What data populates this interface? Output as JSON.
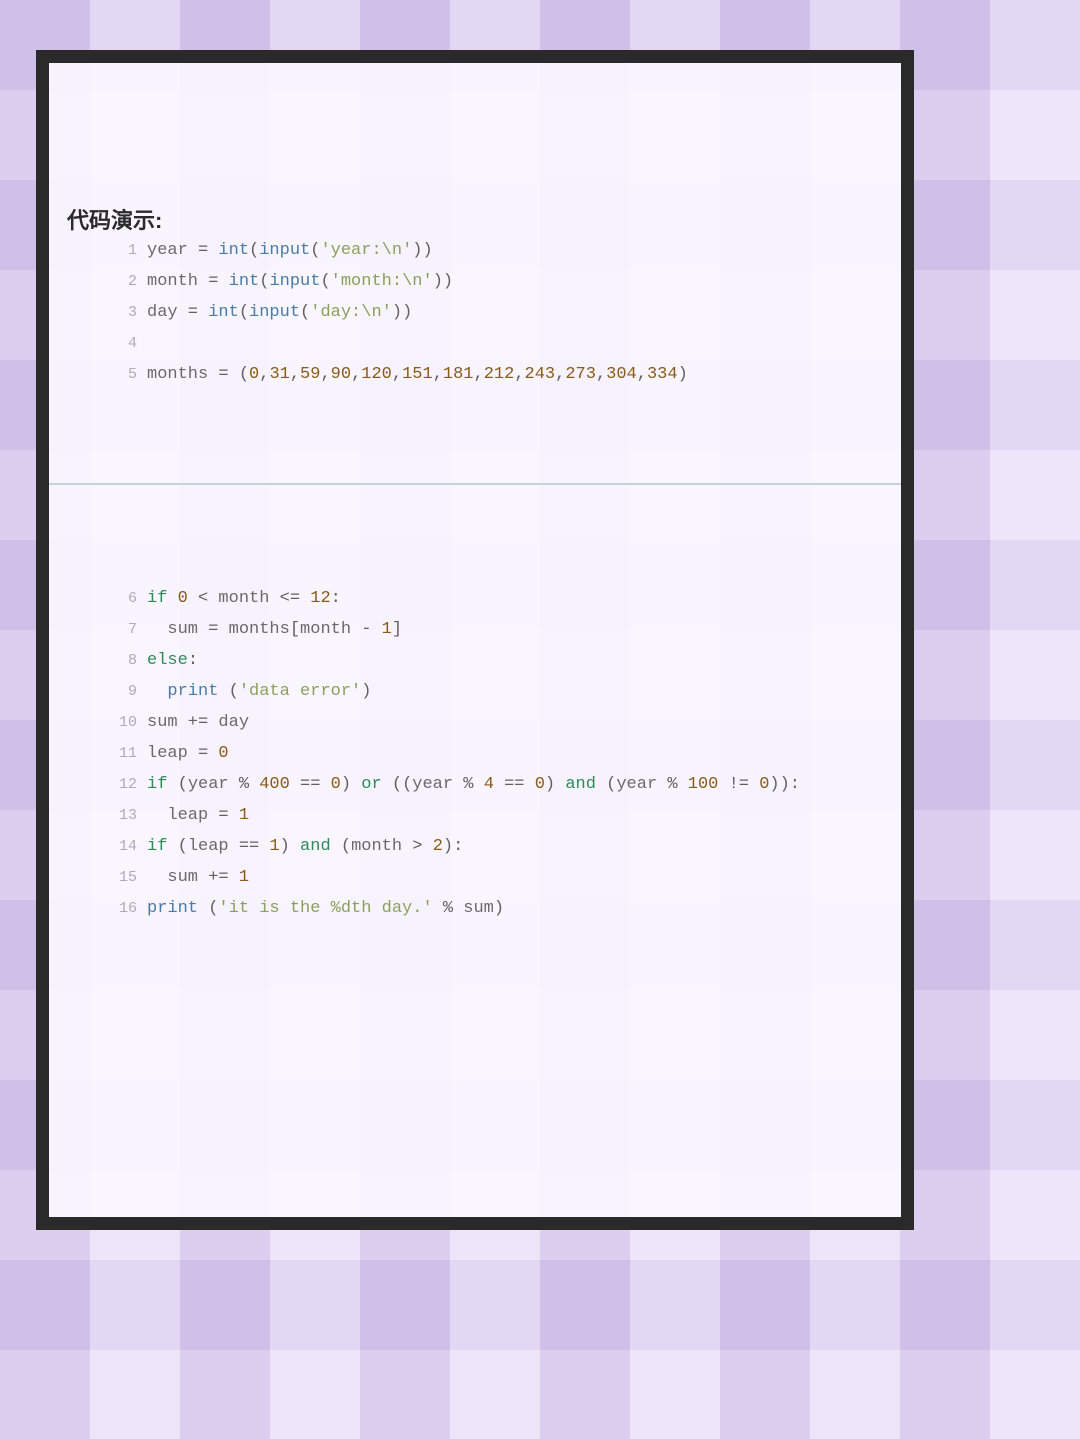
{
  "heading": "代码演示:",
  "colors": {
    "keyword": "#2e8b57",
    "builtin": "#4a7ba6",
    "identifier": "#6a6a6a",
    "operator": "#606060",
    "number": "#8a5a18",
    "string": "#8aa05c",
    "gutter": "#b0a8bc",
    "border": "#2a2a2a"
  },
  "block1": [
    {
      "num": "1",
      "tokens": [
        {
          "t": "year",
          "c": "var"
        },
        {
          "t": " = ",
          "c": "op"
        },
        {
          "t": "int",
          "c": "fn"
        },
        {
          "t": "(",
          "c": "punc"
        },
        {
          "t": "input",
          "c": "fn"
        },
        {
          "t": "(",
          "c": "punc"
        },
        {
          "t": "'year:\\n'",
          "c": "str"
        },
        {
          "t": ")",
          "c": "punc"
        },
        {
          "t": ")",
          "c": "punc"
        }
      ]
    },
    {
      "num": "2",
      "tokens": [
        {
          "t": "month",
          "c": "var"
        },
        {
          "t": " = ",
          "c": "op"
        },
        {
          "t": "int",
          "c": "fn"
        },
        {
          "t": "(",
          "c": "punc"
        },
        {
          "t": "input",
          "c": "fn"
        },
        {
          "t": "(",
          "c": "punc"
        },
        {
          "t": "'month:\\n'",
          "c": "str"
        },
        {
          "t": ")",
          "c": "punc"
        },
        {
          "t": ")",
          "c": "punc"
        }
      ]
    },
    {
      "num": "3",
      "tokens": [
        {
          "t": "day",
          "c": "var"
        },
        {
          "t": " = ",
          "c": "op"
        },
        {
          "t": "int",
          "c": "fn"
        },
        {
          "t": "(",
          "c": "punc"
        },
        {
          "t": "input",
          "c": "fn"
        },
        {
          "t": "(",
          "c": "punc"
        },
        {
          "t": "'day:\\n'",
          "c": "str"
        },
        {
          "t": ")",
          "c": "punc"
        },
        {
          "t": ")",
          "c": "punc"
        }
      ]
    },
    {
      "num": "4",
      "tokens": []
    },
    {
      "num": "5",
      "tokens": [
        {
          "t": "months",
          "c": "var"
        },
        {
          "t": " = ",
          "c": "op"
        },
        {
          "t": "(",
          "c": "punc"
        },
        {
          "t": "0",
          "c": "num"
        },
        {
          "t": ",",
          "c": "punc"
        },
        {
          "t": "31",
          "c": "num"
        },
        {
          "t": ",",
          "c": "punc"
        },
        {
          "t": "59",
          "c": "num"
        },
        {
          "t": ",",
          "c": "punc"
        },
        {
          "t": "90",
          "c": "num"
        },
        {
          "t": ",",
          "c": "punc"
        },
        {
          "t": "120",
          "c": "num"
        },
        {
          "t": ",",
          "c": "punc"
        },
        {
          "t": "151",
          "c": "num"
        },
        {
          "t": ",",
          "c": "punc"
        },
        {
          "t": "181",
          "c": "num"
        },
        {
          "t": ",",
          "c": "punc"
        },
        {
          "t": "212",
          "c": "num"
        },
        {
          "t": ",",
          "c": "punc"
        },
        {
          "t": "243",
          "c": "num"
        },
        {
          "t": ",",
          "c": "punc"
        },
        {
          "t": "273",
          "c": "num"
        },
        {
          "t": ",",
          "c": "punc"
        },
        {
          "t": "304",
          "c": "num"
        },
        {
          "t": ",",
          "c": "punc"
        },
        {
          "t": "334",
          "c": "num"
        },
        {
          "t": ")",
          "c": "punc"
        }
      ]
    }
  ],
  "block2": [
    {
      "num": "6",
      "tokens": [
        {
          "t": "if",
          "c": "kw"
        },
        {
          "t": " ",
          "c": "op"
        },
        {
          "t": "0",
          "c": "num"
        },
        {
          "t": " < ",
          "c": "op"
        },
        {
          "t": "month",
          "c": "var"
        },
        {
          "t": " <= ",
          "c": "op"
        },
        {
          "t": "12",
          "c": "num"
        },
        {
          "t": ":",
          "c": "punc"
        }
      ]
    },
    {
      "num": "7",
      "tokens": [
        {
          "t": "  ",
          "c": "op"
        },
        {
          "t": "sum",
          "c": "var"
        },
        {
          "t": " = ",
          "c": "op"
        },
        {
          "t": "months",
          "c": "var"
        },
        {
          "t": "[",
          "c": "punc"
        },
        {
          "t": "month",
          "c": "var"
        },
        {
          "t": " - ",
          "c": "op"
        },
        {
          "t": "1",
          "c": "num"
        },
        {
          "t": "]",
          "c": "punc"
        }
      ]
    },
    {
      "num": "8",
      "tokens": [
        {
          "t": "else",
          "c": "kw"
        },
        {
          "t": ":",
          "c": "punc"
        }
      ]
    },
    {
      "num": "9",
      "tokens": [
        {
          "t": "  ",
          "c": "op"
        },
        {
          "t": "print",
          "c": "fn"
        },
        {
          "t": " (",
          "c": "punc"
        },
        {
          "t": "'data error'",
          "c": "str"
        },
        {
          "t": ")",
          "c": "punc"
        }
      ]
    },
    {
      "num": "10",
      "tokens": [
        {
          "t": "sum",
          "c": "var"
        },
        {
          "t": " += ",
          "c": "op"
        },
        {
          "t": "day",
          "c": "var"
        }
      ]
    },
    {
      "num": "11",
      "tokens": [
        {
          "t": "leap",
          "c": "var"
        },
        {
          "t": " = ",
          "c": "op"
        },
        {
          "t": "0",
          "c": "num"
        }
      ]
    },
    {
      "num": "12",
      "tokens": [
        {
          "t": "if",
          "c": "kw"
        },
        {
          "t": " (",
          "c": "punc"
        },
        {
          "t": "year",
          "c": "var"
        },
        {
          "t": " % ",
          "c": "op"
        },
        {
          "t": "400",
          "c": "num"
        },
        {
          "t": " == ",
          "c": "op"
        },
        {
          "t": "0",
          "c": "num"
        },
        {
          "t": ") ",
          "c": "punc"
        },
        {
          "t": "or",
          "c": "kw"
        },
        {
          "t": " ((",
          "c": "punc"
        },
        {
          "t": "year",
          "c": "var"
        },
        {
          "t": " % ",
          "c": "op"
        },
        {
          "t": "4",
          "c": "num"
        },
        {
          "t": " == ",
          "c": "op"
        },
        {
          "t": "0",
          "c": "num"
        },
        {
          "t": ") ",
          "c": "punc"
        },
        {
          "t": "and",
          "c": "kw"
        },
        {
          "t": " (",
          "c": "punc"
        },
        {
          "t": "year",
          "c": "var"
        },
        {
          "t": " % ",
          "c": "op"
        },
        {
          "t": "100",
          "c": "num"
        },
        {
          "t": " != ",
          "c": "op"
        },
        {
          "t": "0",
          "c": "num"
        },
        {
          "t": ")):",
          "c": "punc"
        }
      ]
    },
    {
      "num": "13",
      "tokens": [
        {
          "t": "  ",
          "c": "op"
        },
        {
          "t": "leap",
          "c": "var"
        },
        {
          "t": " = ",
          "c": "op"
        },
        {
          "t": "1",
          "c": "num"
        }
      ]
    },
    {
      "num": "14",
      "tokens": [
        {
          "t": "if",
          "c": "kw"
        },
        {
          "t": " (",
          "c": "punc"
        },
        {
          "t": "leap",
          "c": "var"
        },
        {
          "t": " == ",
          "c": "op"
        },
        {
          "t": "1",
          "c": "num"
        },
        {
          "t": ") ",
          "c": "punc"
        },
        {
          "t": "and",
          "c": "kw"
        },
        {
          "t": " (",
          "c": "punc"
        },
        {
          "t": "month",
          "c": "var"
        },
        {
          "t": " > ",
          "c": "op"
        },
        {
          "t": "2",
          "c": "num"
        },
        {
          "t": "):",
          "c": "punc"
        }
      ]
    },
    {
      "num": "15",
      "tokens": [
        {
          "t": "  ",
          "c": "op"
        },
        {
          "t": "sum",
          "c": "var"
        },
        {
          "t": " += ",
          "c": "op"
        },
        {
          "t": "1",
          "c": "num"
        }
      ]
    },
    {
      "num": "16",
      "tokens": [
        {
          "t": "print",
          "c": "fn"
        },
        {
          "t": " (",
          "c": "punc"
        },
        {
          "t": "'it is the %dth day.'",
          "c": "str"
        },
        {
          "t": " % ",
          "c": "op"
        },
        {
          "t": "sum",
          "c": "var"
        },
        {
          "t": ")",
          "c": "punc"
        }
      ]
    }
  ]
}
